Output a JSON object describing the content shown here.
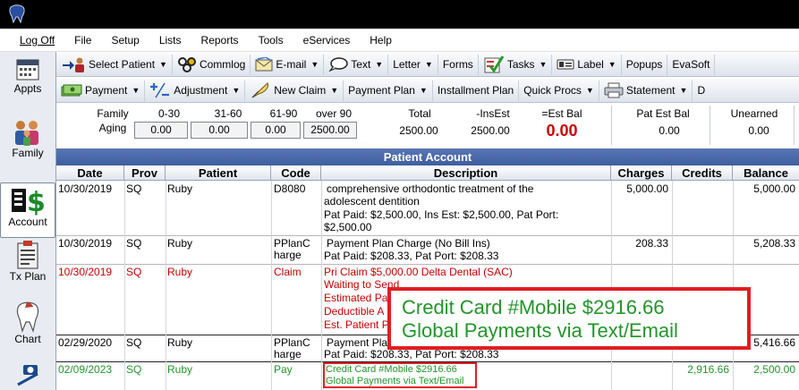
{
  "menu": [
    "Log Off",
    "File",
    "Setup",
    "Lists",
    "Reports",
    "Tools",
    "eServices",
    "Help"
  ],
  "modules": [
    {
      "label": "Appts"
    },
    {
      "label": "Family"
    },
    {
      "label": "Account"
    },
    {
      "label": "Tx Plan"
    },
    {
      "label": "Chart"
    }
  ],
  "toolbar1": [
    "Select Patient",
    "Commlog",
    "E-mail",
    "Text",
    "Letter",
    "Forms",
    "Tasks",
    "Label",
    "Popups",
    "EvaSoft"
  ],
  "toolbar2": [
    "Payment",
    "Adjustment",
    "New Claim",
    "Payment Plan",
    "Installment Plan",
    "Quick Procs",
    "Statement",
    "D"
  ],
  "aging": {
    "family_label": "Family",
    "aging_label": "Aging",
    "b0_30": "0-30",
    "b31_60": "31-60",
    "b61_90": "61-90",
    "over90": "over 90",
    "v0_30": "0.00",
    "v31_60": "0.00",
    "v61_90": "0.00",
    "vover90": "2500.00",
    "total_label": "Total",
    "total": "2500.00",
    "insest_label": "-InsEst",
    "insest": "2500.00",
    "estbal_label": "=Est Bal",
    "estbal": "0.00",
    "patest_label": "Pat Est Bal",
    "patest": "0.00",
    "unearned_label": "Unearned",
    "unearned": "0.00"
  },
  "grid": {
    "title": "Patient Account",
    "columns": [
      "Date",
      "Prov",
      "Patient",
      "Code",
      "Description",
      "Charges",
      "Credits",
      "Balance"
    ],
    "rows": [
      {
        "date": "10/30/2019",
        "prov": "SQ",
        "patient": "Ruby",
        "code": "D8080",
        "desc": [
          "comprehensive orthodontic treatment of the",
          "adolescent dentition",
          "Pat Paid: $2,500.00, Ins Est: $2,500.00, Pat Port:",
          "$2,500.00"
        ],
        "charges": "5,000.00",
        "credits": "",
        "balance": "5,000.00"
      },
      {
        "date": "10/30/2019",
        "prov": "SQ",
        "patient": "Ruby",
        "code": "PPlanC harge",
        "desc": [
          "Payment Plan Charge  (No Bill Ins)",
          "Pat Paid: $208.33, Pat Port: $208.33"
        ],
        "charges": "208.33",
        "credits": "",
        "balance": "5,208.33"
      },
      {
        "date": "10/30/2019",
        "prov": "SQ",
        "patient": "Ruby",
        "code": "Claim",
        "desc": [
          "Pri Claim $5,000.00 Delta Dental (SAC)",
          "Waiting to Send",
          "Estimated Pa",
          "Deductible A",
          "Est. Patient P"
        ],
        "charges": "",
        "credits": "",
        "balance": ""
      },
      {
        "date": "02/29/2020",
        "prov": "SQ",
        "patient": "Ruby",
        "code": "PPlanC harge",
        "desc": [
          "Payment Pla",
          "Pat Paid: $208.33, Pat Port: $208.33"
        ],
        "charges": "",
        "credits": "",
        "balance": "5,416.66"
      },
      {
        "date": "02/09/2023",
        "prov": "SQ",
        "patient": "Ruby",
        "code": "Pay",
        "desc": [
          "Credit Card #Mobile $2916.66",
          "Global Payments via Text/Email"
        ],
        "charges": "",
        "credits": "2,916.66",
        "balance": "2,500.00"
      }
    ]
  },
  "callout": {
    "line1": "Credit Card #Mobile $2916.66",
    "line2": "Global Payments via Text/Email"
  },
  "colors": {
    "red_text": "#cc0000",
    "green_text": "#22962a",
    "header_blue": "#4a69a8",
    "callout_border": "#e11d24"
  }
}
